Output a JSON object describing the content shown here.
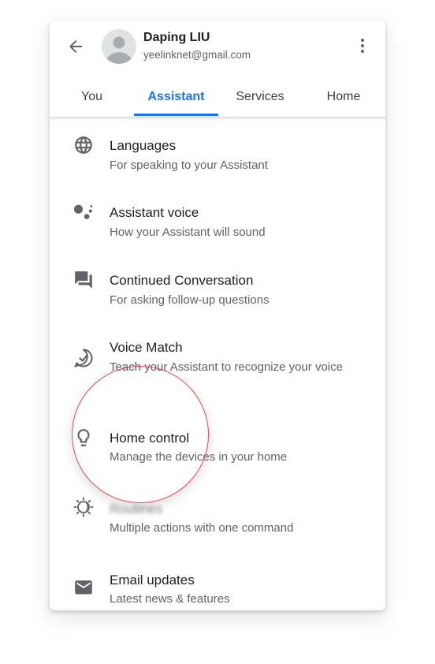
{
  "account": {
    "name": "Daping LIU",
    "email": "yeelinknet@gmail.com"
  },
  "tabs": [
    {
      "label": "You"
    },
    {
      "label": "Assistant"
    },
    {
      "label": "Services"
    },
    {
      "label": "Home"
    }
  ],
  "active_tab": "Assistant",
  "settings": [
    {
      "title": "Languages",
      "subtitle": "For speaking to your Assistant",
      "icon": "globe-icon"
    },
    {
      "title": "Assistant voice",
      "subtitle": "How your Assistant will sound",
      "icon": "assistant-dots-icon"
    },
    {
      "title": "Continued Conversation",
      "subtitle": "For asking follow-up questions",
      "icon": "chat-bubbles-icon"
    },
    {
      "title": "Voice Match",
      "subtitle": "Teach your Assistant to recognize your voice",
      "icon": "voice-match-icon"
    },
    {
      "title": "Home control",
      "subtitle": "Manage the devices in your home",
      "icon": "lightbulb-icon"
    },
    {
      "title": "Routines",
      "subtitle": "Multiple actions with one command",
      "icon": "routines-icon"
    },
    {
      "title": "Email updates",
      "subtitle": "Latest news & features",
      "icon": "mail-icon"
    }
  ],
  "highlighted_item": "Home control",
  "colors": {
    "accent": "#1a73e8",
    "highlight_ring": "#e64452",
    "icon": "#5f6368"
  }
}
